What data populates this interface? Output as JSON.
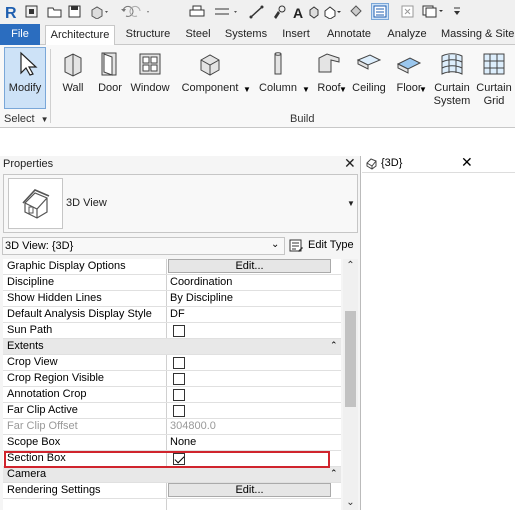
{
  "tabs": {
    "file": "File",
    "items": [
      "Architecture",
      "Structure",
      "Steel",
      "Systems",
      "Insert",
      "Annotate",
      "Analyze",
      "Massing & Site"
    ]
  },
  "ribbon": {
    "modify": "Modify",
    "wall": "Wall",
    "door": "Door",
    "window": "Window",
    "component": "Component",
    "column": "Column",
    "roof": "Roof",
    "ceiling": "Ceiling",
    "floor": "Floor",
    "curtain_system_1": "Curtain",
    "curtain_system_2": "System",
    "curtain_grid_1": "Curtain",
    "curtain_grid_2": "Grid",
    "panel_select": "Select",
    "panel_build": "Build"
  },
  "properties": {
    "title": "Properties",
    "type_name": "3D View",
    "instance": "3D View: {3D}",
    "edit_type": "Edit Type",
    "rows": [
      {
        "name": "Graphic Display Options",
        "value": "Edit..."
      },
      {
        "name": "Discipline",
        "value": "Coordination"
      },
      {
        "name": "Show Hidden Lines",
        "value": "By Discipline"
      },
      {
        "name": "Default Analysis Display Style",
        "value": "DF"
      },
      {
        "name": "Sun Path",
        "value": ""
      },
      {
        "name": "Extents",
        "value": ""
      },
      {
        "name": "Crop View",
        "value": ""
      },
      {
        "name": "Crop Region Visible",
        "value": ""
      },
      {
        "name": "Annotation Crop",
        "value": ""
      },
      {
        "name": "Far Clip Active",
        "value": ""
      },
      {
        "name": "Far Clip Offset",
        "value": "304800.0"
      },
      {
        "name": "Scope Box",
        "value": "None"
      },
      {
        "name": "Section Box",
        "value": ""
      },
      {
        "name": "Camera",
        "value": ""
      },
      {
        "name": "Rendering Settings",
        "value": "Edit..."
      }
    ]
  },
  "view": {
    "title": "{3D}"
  }
}
